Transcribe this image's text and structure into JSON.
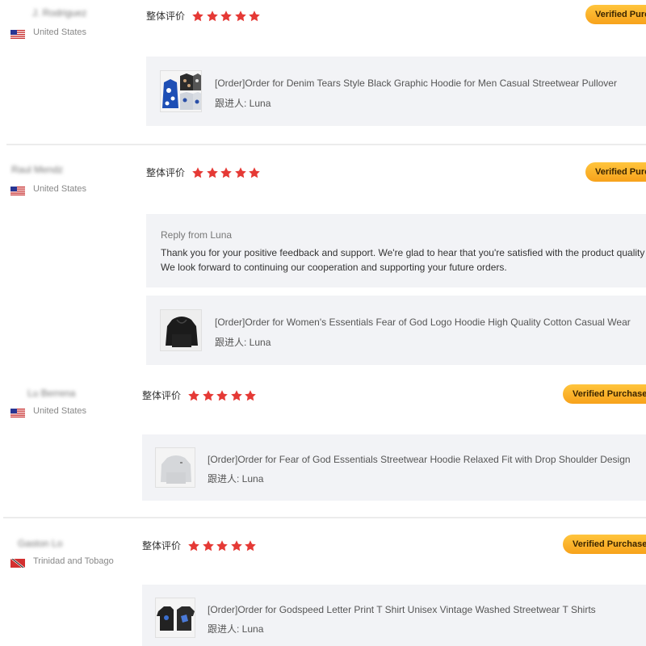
{
  "rating_label": "整体评价",
  "stars_count": 5,
  "star_color": "#e53935",
  "badge_color": "#f7a21b",
  "reviews": [
    {
      "user_name": "J. Rodriguez",
      "country": "United States",
      "flag_icon": "us-flag-icon",
      "badge": "Verified Purc",
      "order": {
        "title": "[Order]Order for Denim Tears Style Black Graphic Hoodie for Men Casual Streetwear Pullover",
        "follow": "跟进人: Luna"
      }
    },
    {
      "user_name": "Raul Mendz",
      "country": "United States",
      "flag_icon": "us-flag-icon",
      "badge": "Verified Purc",
      "reply": {
        "title": "Reply from Luna",
        "line1": "Thank you for your positive feedback and support. We're glad to hear that you're satisfied with the product quality",
        "line2": "We look forward to continuing our cooperation and supporting your future orders."
      },
      "order": {
        "title": "[Order]Order for Women's Essentials Fear of God Logo Hoodie High Quality Cotton Casual Wear",
        "follow": "跟进人: Luna"
      }
    },
    {
      "user_name": "Lu Berrena",
      "country": "United States",
      "flag_icon": "us-flag-icon",
      "badge": "Verified Purchase",
      "order": {
        "title": "[Order]Order for Fear of God Essentials Streetwear Hoodie Relaxed Fit with Drop Shoulder Design",
        "follow": "跟进人: Luna"
      }
    },
    {
      "user_name": "Gaston Lo",
      "country": "Trinidad and Tobago",
      "flag_icon": "trinidad-tobago-flag-icon",
      "badge": "Verified Purchase",
      "order": {
        "title": "[Order]Order for Godspeed Letter Print T Shirt Unisex Vintage Washed Streetwear T Shirts",
        "follow": "跟进人: Luna"
      }
    }
  ]
}
